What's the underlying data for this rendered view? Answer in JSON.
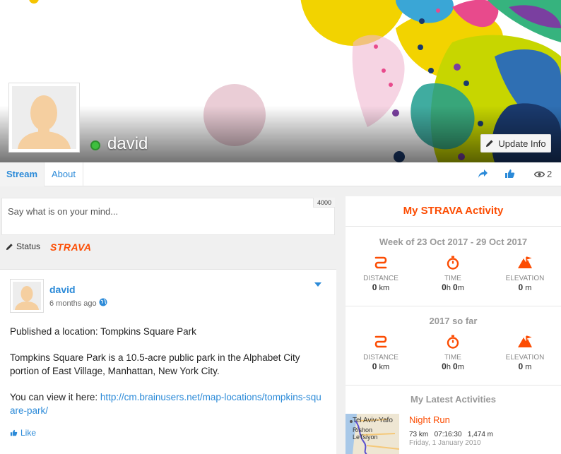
{
  "profile": {
    "name": "david",
    "update_button": "Update Info"
  },
  "tabs": {
    "stream": "Stream",
    "about": "About",
    "views_count": "2"
  },
  "composer": {
    "placeholder": "Say what is on your mind...",
    "char_limit": "4000",
    "status_label": "Status",
    "strava_label": "STRAVA"
  },
  "post": {
    "author": "david",
    "time": "6 months ago",
    "line1": "Published a location: Tompkins Square Park",
    "line2": "Tompkins Square Park is a 10.5-acre public park in the Alphabet City portion of East Village, Manhattan, New York City.",
    "line3_prefix": "You can view it here: ",
    "link": "http://cm.brainusers.net/map-locations/tompkins-square-park/",
    "like_label": "Like"
  },
  "strava": {
    "title": "My STRAVA Activity",
    "week_title": "Week of 23 Oct 2017 - 29 Oct 2017",
    "year_title": "2017 so far",
    "labels": {
      "distance": "DISTANCE",
      "time": "TIME",
      "elevation": "ELEVATION"
    },
    "week": {
      "distance": "0",
      "distance_unit": "km",
      "time_h": "0",
      "time_m": "0",
      "elevation": "0",
      "elevation_unit": "m"
    },
    "year": {
      "distance": "0",
      "distance_unit": "km",
      "time_h": "0",
      "time_m": "0",
      "elevation": "0",
      "elevation_unit": "m"
    },
    "units": {
      "h": "h",
      "m": "m"
    },
    "latest_title": "My Latest Activities",
    "activity": {
      "name": "Night Run",
      "distance": "73 km",
      "duration": "07:16:30",
      "elevation": "1,474 m",
      "date": "Friday, 1 January 2010",
      "map_labels": [
        "Tel Aviv-Yafo",
        "Rishon",
        "LeTsiyon"
      ]
    },
    "accent_color": "#fc4c02"
  },
  "colors": {
    "link": "#2b8ad8",
    "online": "#3fbf3f"
  }
}
